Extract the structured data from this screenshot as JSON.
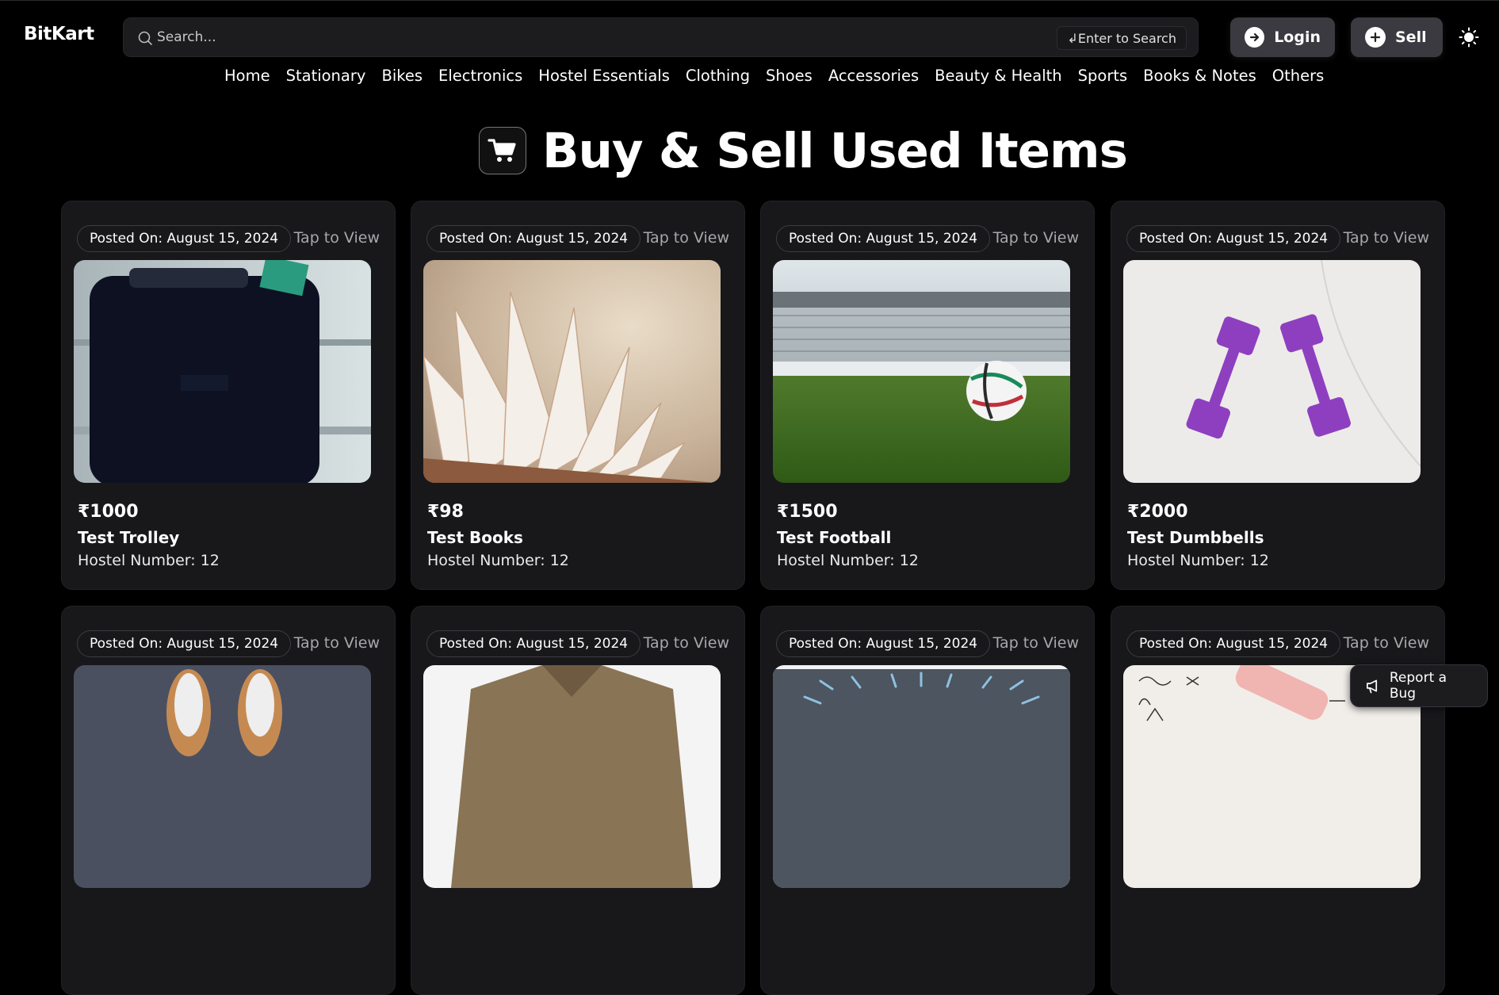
{
  "app": {
    "brand": "BitKart"
  },
  "search": {
    "placeholder": "Search...",
    "hint": "↲Enter to Search"
  },
  "header": {
    "login_label": "Login",
    "sell_label": "Sell"
  },
  "nav": {
    "items": [
      "Home",
      "Stationary",
      "Bikes",
      "Electronics",
      "Hostel Essentials",
      "Clothing",
      "Shoes",
      "Accessories",
      "Beauty & Health",
      "Sports",
      "Books & Notes",
      "Others"
    ]
  },
  "hero": {
    "title": "Buy & Sell Used Items"
  },
  "cards": [
    {
      "posted": "Posted On: August 15, 2024",
      "tap": "Tap to View",
      "price": "₹1000",
      "title": "Test Trolley",
      "hostel": "Hostel Number: 12",
      "image": "trolley"
    },
    {
      "posted": "Posted On: August 15, 2024",
      "tap": "Tap to View",
      "price": "₹98",
      "title": "Test Books",
      "hostel": "Hostel Number: 12",
      "image": "book"
    },
    {
      "posted": "Posted On: August 15, 2024",
      "tap": "Tap to View",
      "price": "₹1500",
      "title": "Test Football",
      "hostel": "Hostel Number: 12",
      "image": "football"
    },
    {
      "posted": "Posted On: August 15, 2024",
      "tap": "Tap to View",
      "price": "₹2000",
      "title": "Test Dumbbells",
      "hostel": "Hostel Number: 12",
      "image": "dumbbells"
    },
    {
      "posted": "Posted On: August 15, 2024",
      "tap": "Tap to View",
      "image": "shoes"
    },
    {
      "posted": "Posted On: August 15, 2024",
      "tap": "Tap to View",
      "image": "shirt"
    },
    {
      "posted": "Posted On: August 15, 2024",
      "tap": "Tap to View",
      "image": "gadget"
    },
    {
      "posted": "Posted On: August 15, 2024",
      "tap": "Tap to View",
      "image": "notes"
    }
  ],
  "report": {
    "label": "Report a Bug"
  }
}
